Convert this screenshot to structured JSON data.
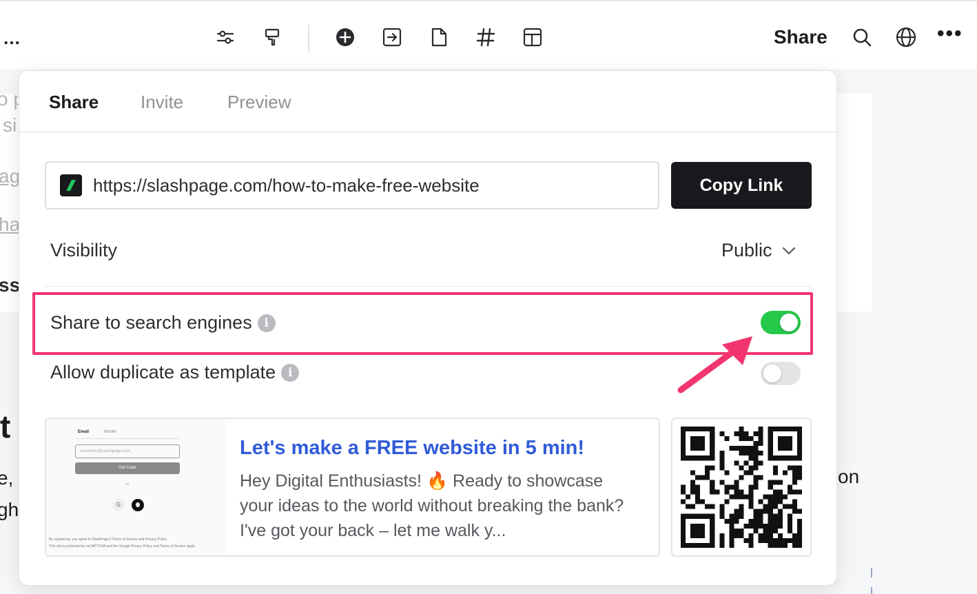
{
  "toolbar": {
    "ellipsis_left": "…",
    "share_label": "Share",
    "more_label": "•••",
    "icons": [
      "sliders-icon",
      "paint-roller-icon",
      "add-circle-icon",
      "export-icon",
      "page-icon",
      "hashtag-icon",
      "layout-icon",
      "search-icon",
      "globe-icon"
    ]
  },
  "background": {
    "fragments": [
      "o p",
      "si",
      "ag",
      "ha",
      "ss",
      "t",
      "e,",
      "gh",
      "on"
    ]
  },
  "share_panel": {
    "tabs": [
      {
        "label": "Share",
        "active": true
      },
      {
        "label": "Invite",
        "active": false
      },
      {
        "label": "Preview",
        "active": false
      }
    ],
    "url": "https://slashpage.com/how-to-make-free-website",
    "copy_button": "Copy Link",
    "visibility": {
      "label": "Visibility",
      "value": "Public"
    },
    "search_engines": {
      "label": "Share to search engines",
      "enabled": true
    },
    "duplicate_template": {
      "label": "Allow duplicate as template",
      "enabled": false
    },
    "preview": {
      "title": "Let's make a FREE website in 5 min!",
      "description": "Hey Digital Enthusiasts! 🔥 Ready to showcase your ideas to the world without breaking the bank? I've got your back – let me walk y...",
      "thumbnail": {
        "tab_email": "Email",
        "tab_mobile": "Mobile",
        "input_placeholder": "username@slashpage.com",
        "button": "Get Code",
        "or": "or",
        "google": "G",
        "fine_print_1": "By registering, you agree to SlashPage's Terms of Service and Privacy Policy",
        "fine_print_2": "This site is protected by reCAPTCHA and the Google Privacy Policy and Terms of Service apply."
      }
    }
  },
  "colors": {
    "accent_toggle_on": "#25c94a",
    "highlight": "#f2356f",
    "link_title": "#2f5bd8",
    "primary_button": "#17191c"
  }
}
